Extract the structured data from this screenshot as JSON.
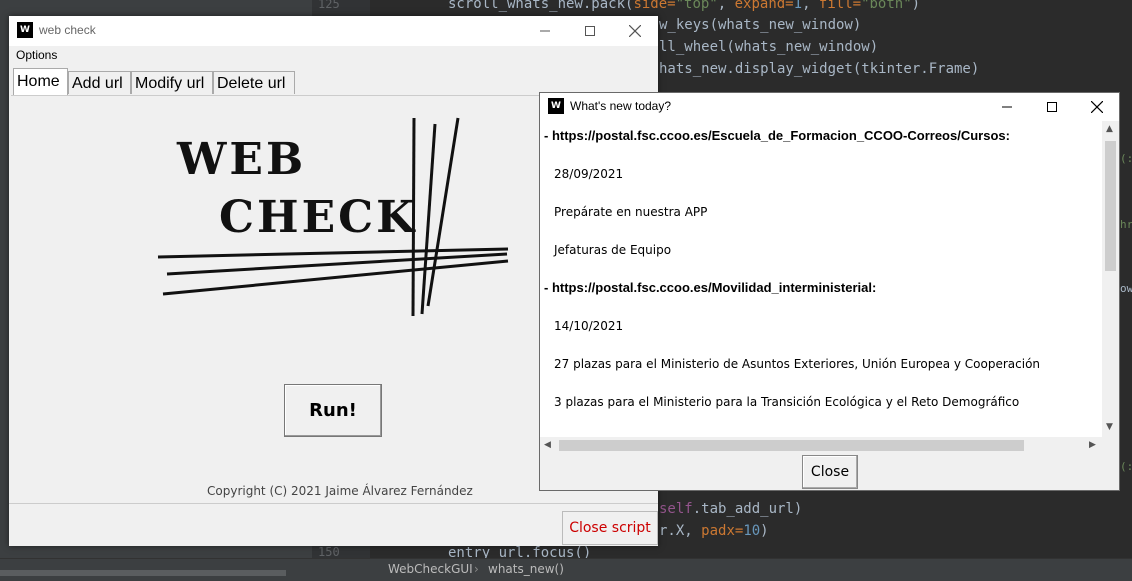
{
  "ide": {
    "line_numbers": [
      "125",
      "150"
    ],
    "code_lines": [
      {
        "pre": "scroll_whats_new.pack(",
        "kw": "side=",
        "str": "\"top\"",
        "post": ", ",
        "kw2": "expand=",
        "num": "1",
        "post2": ", ",
        "kw3": "fill=",
        "str2": "\"both\"",
        "end": ")"
      },
      {
        "text": "w_keys(whats_new_window)"
      },
      {
        "text": "ll_wheel(whats_new_window)"
      },
      {
        "text": "hats_new.display_widget(tkinter.Frame)"
      },
      {
        "self": "self",
        "text": ".tab_add_url)"
      },
      {
        "text": "r.X, ",
        "kw": "padx=",
        "num": "10",
        "end": ")"
      },
      {
        "text": "entry_url.focus()"
      }
    ],
    "breadcrumb": [
      "WebCheckGUI",
      "whats_new()"
    ]
  },
  "main_window": {
    "title": "web check",
    "app_icon_text": "W",
    "menu": "Options",
    "tabs": [
      "Home",
      "Add url",
      "Modify url",
      "Delete url"
    ],
    "logo_line1": "WEB",
    "logo_line2": "CHECK",
    "run_label": "Run!",
    "copyright": "Copyright (C) 2021 Jaime Álvarez Fernández",
    "close_script_label": "Close script"
  },
  "whats_new_window": {
    "title": "What's new today?",
    "app_icon_text": "W",
    "entries": [
      {
        "url": "- https://postal.fsc.ccoo.es/Escuela_de_Formacion_CCOO-Correos/Cursos:",
        "lines": [
          "28/09/2021",
          "Prepárate en nuestra APP",
          "Jefaturas de Equipo"
        ]
      },
      {
        "url": "- https://postal.fsc.ccoo.es/Movilidad_interministerial:",
        "lines": [
          "14/10/2021",
          "27 plazas para el Ministerio de Asuntos Exteriores, Unión Europea y Cooperación",
          "3 plazas para el Ministerio para la Transición Ecológica y el Reto Demográfico"
        ]
      }
    ],
    "close_label": "Close"
  }
}
